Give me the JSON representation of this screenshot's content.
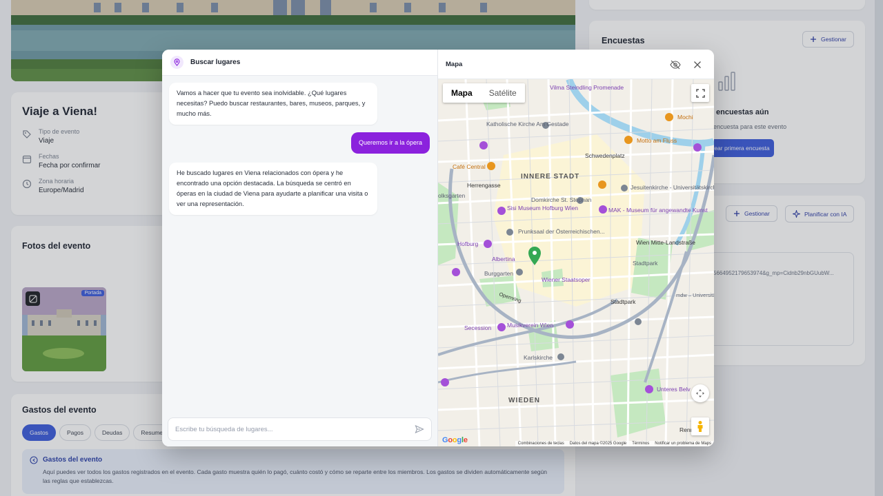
{
  "trip": {
    "title": "Viaje a Viena!",
    "type_label": "Tipo de evento",
    "type_value": "Viaje",
    "dates_label": "Fechas",
    "dates_value": "Fecha por confirmar",
    "tz_label": "Zona horaria",
    "tz_value": "Europe/Madrid"
  },
  "photos": {
    "title": "Fotos del evento",
    "cover_tag": "Portada"
  },
  "expenses": {
    "title": "Gastos del evento",
    "tabs": [
      "Gastos",
      "Pagos",
      "Deudas",
      "Resumen"
    ],
    "info_title": "Gastos del evento",
    "info_text": "Aquí puedes ver todos los gastos registrados en el evento. Cada gasto muestra quién lo pagó, cuánto costó y cómo se reparte entre los miembros. Los gastos se dividen automáticamente según las reglas que establezcas."
  },
  "surveys": {
    "title": "Encuestas",
    "manage": "Gestionar",
    "empty_title": "encuestas aún",
    "empty_sub": "encuesta para este evento",
    "create": "Crear primera encuesta"
  },
  "plan": {
    "manage": "Gestionar",
    "plan_ai": "Planificar con IA",
    "url_fragment": "5664952179653974&g_mp=Cidnb29nbGUubW..."
  },
  "chat": {
    "title": "Buscar lugares",
    "messages": {
      "bot1": "Vamos a hacer que tu evento sea inolvidable. ¿Qué lugares necesitas? Puedo buscar restaurantes, bares, museos, parques, y mucho más.",
      "user1": "Queremos ir a la ópera",
      "bot2": "He buscado lugares en Viena relacionados con ópera y he encontrado una opción destacada. La búsqueda se centró en óperas en la ciudad de Viena para ayudarte a planificar una visita o ver una representación."
    },
    "input_placeholder": "Escribe tu búsqueda de lugares..."
  },
  "map": {
    "title": "Mapa",
    "toggle": {
      "map": "Mapa",
      "satellite": "Satélite"
    },
    "labels": {
      "promenade": "Vilma Steindling Promenade",
      "church": "Katholische Kirche Am Gestade",
      "mochi": "Mochi",
      "motto": "Motto am Fluss",
      "schwedenplatz": "Schwedenplatz",
      "cafe": "Café Central",
      "herrengasse": "Herrengasse",
      "innere": "INNERE STADT",
      "jesuit": "Jesuitenkirche - Universitätskirche",
      "sisi": "Sisi Museum Hofburg Wien",
      "stephan": "Domkirche St. Stephan",
      "mak": "MAK - Museum für angewandte Kunst",
      "prunksaal": "Prunksaal der Österreichischen...",
      "hofburg": "Hofburg",
      "landstrasse": "Wien Mitte-Landstraße",
      "albertina": "Albertina",
      "stadtpark": "Stadtpark",
      "burggarten": "Burggarten",
      "staatsoper": "Wiener Staatsoper",
      "stadtpark_st": "Stadtpark",
      "mdw": "mdw – Universität für Musik und darstellende Kunst Wien",
      "secession": "Secession",
      "musikverein": "Musikverein Wien",
      "karlskirche": "Karlskirche",
      "wieden": "WIEDEN",
      "belvedere": "Unteres Belv",
      "rennweg": "Rennweg",
      "opernring": "Opernring",
      "volksgarten": "olksgarten"
    },
    "footer": {
      "keys": "Combinaciones de teclas",
      "data": "Datos del mapa ©2025 Google",
      "terms": "Términos",
      "report": "Notificar un problema de Maps"
    },
    "google": "Google"
  },
  "colors": {
    "accent": "#3b5bdb",
    "purple": "#8b22dd",
    "map_pin": "#34a853"
  }
}
